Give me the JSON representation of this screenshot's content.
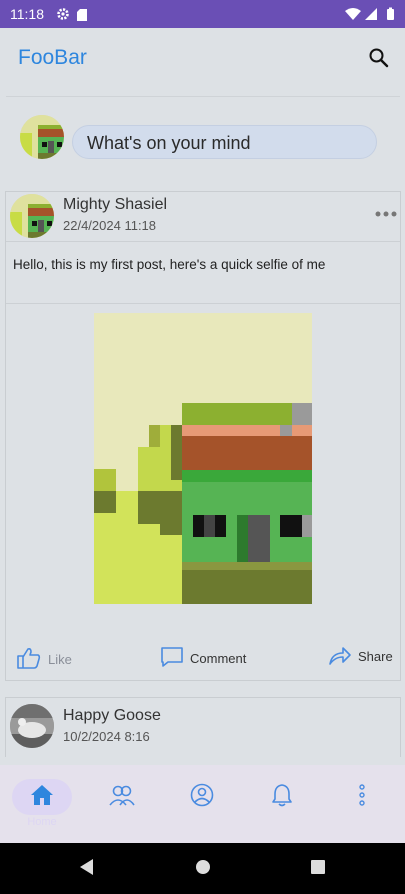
{
  "status_bar": {
    "time": "11:18",
    "icons": [
      "gear-icon",
      "sd-card-icon",
      "wifi-icon",
      "signal-icon",
      "battery-icon"
    ]
  },
  "app_bar": {
    "title": "FooBar",
    "search_icon": "search-icon"
  },
  "composer": {
    "placeholder": "What's on your mind"
  },
  "posts": [
    {
      "author": "Mighty Shasiel",
      "date": "22/4/2024 11:18",
      "text": "Hello, this is my first post, here's a quick selfie of me",
      "actions": {
        "like": "Like",
        "comment": "Comment",
        "share": "Share"
      }
    },
    {
      "author": "Happy Goose",
      "date": "10/2/2024 8:16"
    }
  ],
  "bottom_nav": {
    "items": [
      {
        "label": "Home",
        "icon": "home-icon",
        "selected": true
      },
      {
        "icon": "friends-icon"
      },
      {
        "icon": "profile-icon"
      },
      {
        "icon": "bell-icon"
      },
      {
        "icon": "more-vert-icon"
      }
    ]
  },
  "colors": {
    "accent": "#2e86de",
    "status_bar": "#6a4fb5",
    "nav_background": "#e5e1ec",
    "nav_selected": "#ddd6f3",
    "page_background": "#dde1e5"
  }
}
